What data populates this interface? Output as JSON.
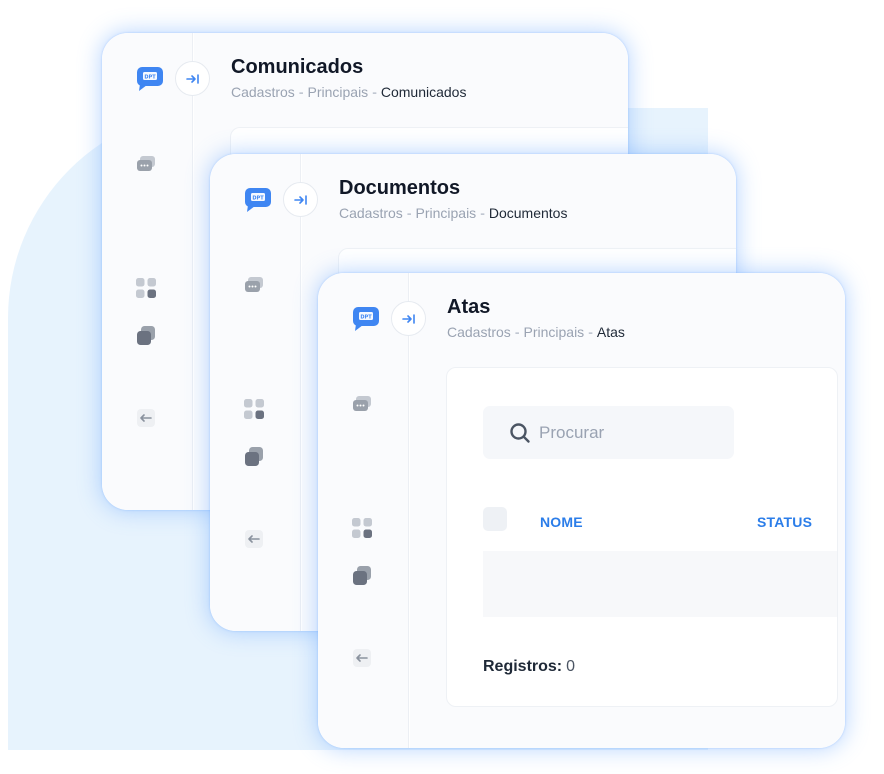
{
  "colors": {
    "accent": "#2b7de9",
    "logo_blue": "#3f86f2",
    "background_blob": "#e7f3fd"
  },
  "logo_text": "DPT",
  "windows": [
    {
      "title": "Comunicados",
      "breadcrumb": [
        "Cadastros",
        "Principais",
        "Comunicados"
      ]
    },
    {
      "title": "Documentos",
      "breadcrumb": [
        "Cadastros",
        "Principais",
        "Documentos"
      ]
    },
    {
      "title": "Atas",
      "breadcrumb": [
        "Cadastros",
        "Principais",
        "Atas"
      ],
      "search": {
        "placeholder": "Procurar"
      },
      "table": {
        "columns": [
          "NOME",
          "STATUS"
        ],
        "rows": []
      },
      "footer": {
        "records_label": "Registros:",
        "records_count": "0"
      }
    }
  ],
  "sidebar_icons": [
    "chat-icon",
    "grid-icon",
    "stack-icon",
    "exit-icon"
  ],
  "toggle_icon": "arrow-right-bar-icon"
}
